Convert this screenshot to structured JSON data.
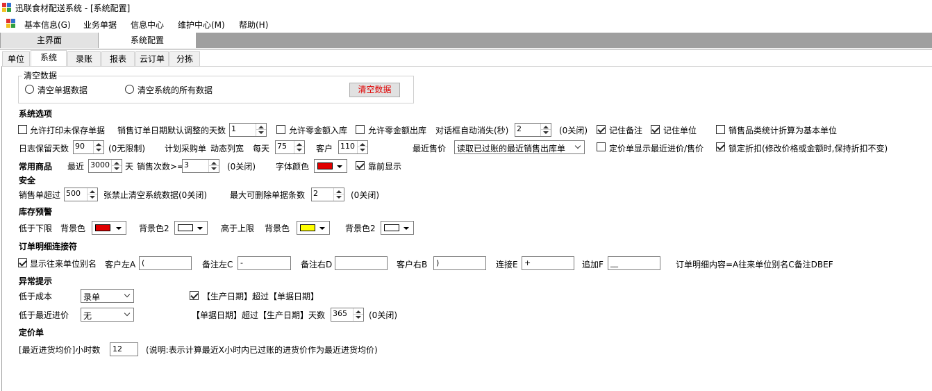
{
  "window": {
    "title": "迅联食材配送系统 - [系统配置]"
  },
  "menu": {
    "items": [
      "基本信息(G)",
      "业务单据",
      "信息中心",
      "维护中心(M)",
      "帮助(H)"
    ]
  },
  "doc_tabs": [
    "主界面",
    "系统配置"
  ],
  "sub_tabs": [
    "单位",
    "系统",
    "录账",
    "报表",
    "云订单",
    "分拣"
  ],
  "clear_data": {
    "group_title": "清空数据",
    "radio_doc": "清空单据数据",
    "radio_all": "清空系统的所有数据",
    "button": "清空数据"
  },
  "system_options": {
    "title": "系统选项",
    "allow_print_unsaved": "允许打印未保存单据",
    "sales_date_days_label": "销售订单日期默认调整的天数",
    "sales_date_days": "1",
    "allow_zero_in": "允许零金额入库",
    "allow_zero_out": "允许零金额出库",
    "dialog_auto_label": "对话框自动消失(秒)",
    "dialog_auto": "2",
    "dialog_auto_hint": "(0关闭)",
    "remember_note": "记住备注",
    "remember_unit": "记住单位",
    "category_stat": "销售品类统计折算为基本单位",
    "log_days_label": "日志保留天数",
    "log_days": "90",
    "log_days_hint": "(0无限制)",
    "purchase_label": "计划采购单",
    "dynamic_cols": "动态列宽",
    "per_day_label": "每天",
    "per_day": "75",
    "customer_label": "客户",
    "customer": "110",
    "recent_price_label": "最近售价",
    "recent_price_value": "读取已过账的最近销售出库单",
    "pricing_show_recent": "定价单显示最近进价/售价",
    "lock_discount": "锁定折扣(修改价格或金额时,保持折扣不变)"
  },
  "common_goods": {
    "title": "常用商品",
    "recent_label": "最近",
    "recent_days": "3000",
    "days_unit": "天",
    "sales_count_label": "销售次数>=",
    "sales_count": "3",
    "sales_count_hint": "(0关闭)",
    "font_color_label": "字体颜色",
    "font_color": "#e00000",
    "show_front": "靠前显示"
  },
  "security": {
    "title": "安全",
    "exceed_label": "销售单超过",
    "exceed_value": "500",
    "exceed_hint": "张禁止清空系统数据(0关闭)",
    "max_delete_label": "最大可删除单据条数",
    "max_delete": "2",
    "max_delete_hint": "(0关闭)"
  },
  "stock_alert": {
    "title": "库存预警",
    "low_label": "低于下限",
    "bg_label": "背景色",
    "bg2_label": "背景色2",
    "high_label": "高于上限",
    "low_bg": "#e00000",
    "low_bg2": "#ffffff",
    "high_bg": "#ffff00",
    "high_bg2": "#ffffff"
  },
  "order_connector": {
    "title": "订单明细连接符",
    "show_alias": "显示往来单位别名",
    "cust_left_label": "客户左A",
    "cust_left": "(",
    "note_left_label": "备注左C",
    "note_left": "-",
    "note_right_label": "备注右D",
    "note_right": "",
    "cust_right_label": "客户右B",
    "cust_right": ")",
    "connect_label": "连接E",
    "connect": "+",
    "append_label": "追加F",
    "append": "__",
    "content_hint": "订单明细内容=A往来单位别名C备注DBEF"
  },
  "exception": {
    "title": "异常提示",
    "below_cost_label": "低于成本",
    "below_cost_value": "录单",
    "prod_date_check": "【生产日期】超过【单据日期】",
    "below_recent_label": "低于最近进价",
    "below_recent_value": "无",
    "doc_date_label": "【单据日期】超过【生产日期】天数",
    "doc_date_days": "365",
    "doc_date_hint": "(0关闭)"
  },
  "pricing": {
    "title": "定价单",
    "hours_label": "[最近进货均价]小时数",
    "hours": "12",
    "hours_hint": "(说明:表示计算最近X小时内已过账的进货价作为最近进货均价)"
  },
  "colors": {
    "tabbar_bg": "#9f9f9f",
    "clear_button_text": "#e00000"
  }
}
